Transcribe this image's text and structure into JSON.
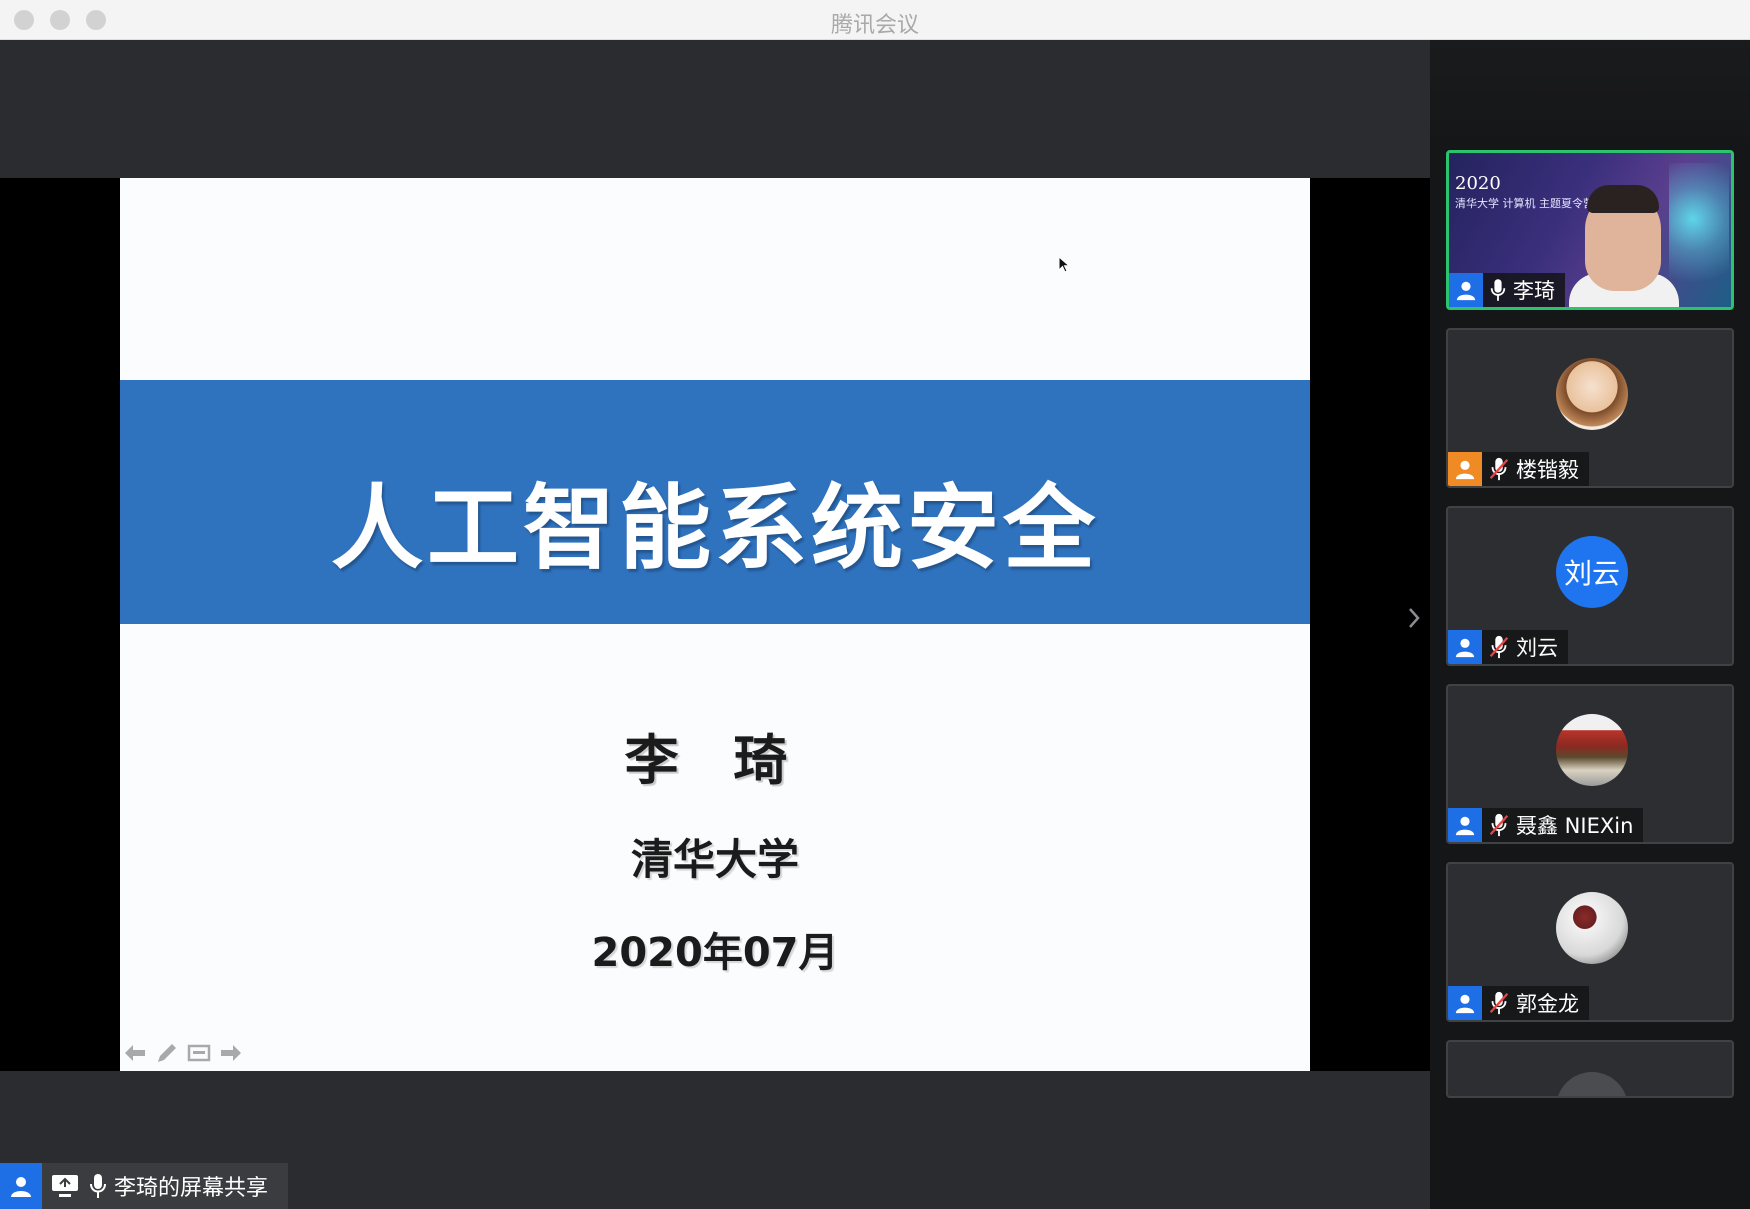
{
  "window": {
    "title": "腾讯会议"
  },
  "slide": {
    "title": "人工智能系统安全",
    "author": "李 琦",
    "org": "清华大学",
    "date": "2020年07月"
  },
  "share_badge": {
    "label": "李琦的屏幕共享"
  },
  "participants": [
    {
      "name": "李琦",
      "mic": "on",
      "video": true,
      "banner_year": "2020",
      "banner_line": "清华大学 计算机 主题夏令营"
    },
    {
      "name": "楼锴毅",
      "mic": "muted",
      "avatar": "image",
      "role_color": "#f08a24"
    },
    {
      "name": "刘云",
      "mic": "muted",
      "avatar": "text",
      "avatar_text": "刘云"
    },
    {
      "name": "聂鑫 NIEXin",
      "mic": "muted",
      "avatar": "image"
    },
    {
      "name": "郭金龙",
      "mic": "muted",
      "avatar": "image"
    }
  ],
  "colors": {
    "slide_band": "#2f72be",
    "accent_blue": "#1e6fe6",
    "active_border": "#2bc46d"
  }
}
